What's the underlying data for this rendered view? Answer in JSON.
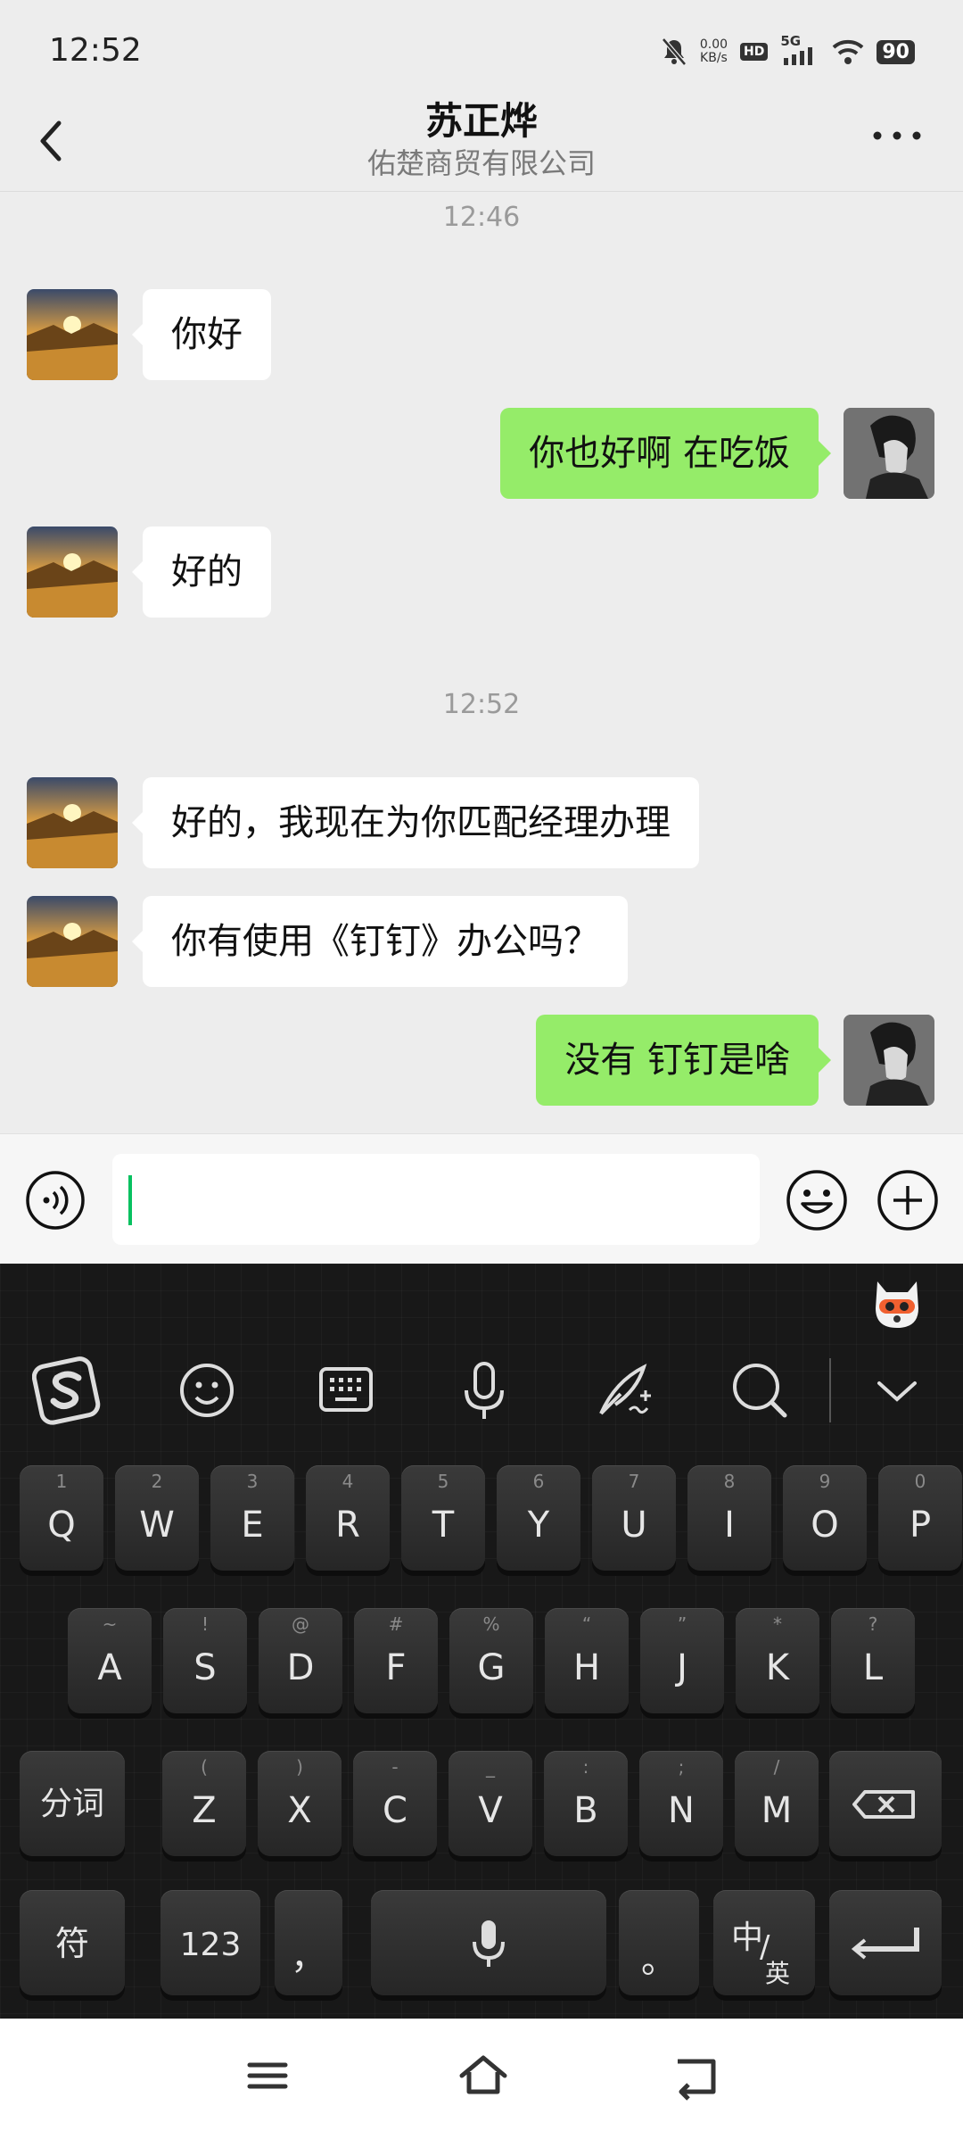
{
  "status_bar": {
    "time": "12:52",
    "net_speed_value": "0.00",
    "net_speed_unit": "KB/s",
    "hd_label": "HD",
    "network_label": "5G",
    "battery": "90"
  },
  "header": {
    "title": "苏正烨",
    "subtitle": "佑楚商贸有限公司"
  },
  "chat": {
    "timestamps": [
      "12:46",
      "12:52"
    ],
    "messages": [
      {
        "side": "in",
        "text": "你好"
      },
      {
        "side": "out",
        "text": "你也好啊 在吃饭"
      },
      {
        "side": "in",
        "text": "好的"
      },
      {
        "side": "in",
        "text": "好的，我现在为你匹配经理办理"
      },
      {
        "side": "in",
        "text": "你有使用《钉钉》办公吗？"
      },
      {
        "side": "out",
        "text": "没有 钉钉是啥"
      }
    ]
  },
  "input": {
    "value": ""
  },
  "keyboard": {
    "row1": [
      {
        "main": "Q",
        "sub": "1"
      },
      {
        "main": "W",
        "sub": "2"
      },
      {
        "main": "E",
        "sub": "3"
      },
      {
        "main": "R",
        "sub": "4"
      },
      {
        "main": "T",
        "sub": "5"
      },
      {
        "main": "Y",
        "sub": "6"
      },
      {
        "main": "U",
        "sub": "7"
      },
      {
        "main": "I",
        "sub": "8"
      },
      {
        "main": "O",
        "sub": "9"
      },
      {
        "main": "P",
        "sub": "0"
      }
    ],
    "row2": [
      {
        "main": "A",
        "sub": "~"
      },
      {
        "main": "S",
        "sub": "!"
      },
      {
        "main": "D",
        "sub": "@"
      },
      {
        "main": "F",
        "sub": "#"
      },
      {
        "main": "G",
        "sub": "%"
      },
      {
        "main": "H",
        "sub": "“"
      },
      {
        "main": "J",
        "sub": "”"
      },
      {
        "main": "K",
        "sub": "*"
      },
      {
        "main": "L",
        "sub": "?"
      }
    ],
    "row3": [
      {
        "main": "Z",
        "sub": "("
      },
      {
        "main": "X",
        "sub": ")"
      },
      {
        "main": "C",
        "sub": "-"
      },
      {
        "main": "V",
        "sub": "_"
      },
      {
        "main": "B",
        "sub": ":"
      },
      {
        "main": "N",
        "sub": ";"
      },
      {
        "main": "M",
        "sub": "/"
      }
    ],
    "fenci": "分词",
    "fu": "符",
    "num": "123",
    "comma": "，",
    "period": "。",
    "zh": "中",
    "en": "英"
  }
}
